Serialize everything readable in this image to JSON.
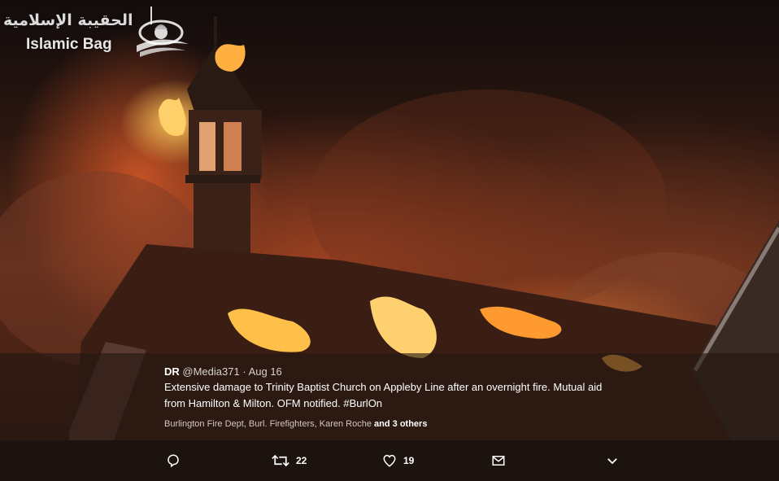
{
  "watermark": {
    "arabic": "الحقيبة الإسلامية",
    "latin": "Islamic Bag"
  },
  "tweet": {
    "display_name": "DR",
    "handle": "@Media371",
    "separator": "·",
    "date": "Aug 16",
    "text": "Extensive damage to Trinity Baptist Church on Appleby Line after an overnight fire. Mutual aid from Hamilton & Milton. OFM notified. #BurlOn",
    "liked_by_names": "Burlington Fire Dept, Burl. Firefighters, Karen Roche",
    "liked_by_and": "and",
    "liked_by_others": "3 others"
  },
  "actions": {
    "reply_icon": "reply-icon",
    "retweet_icon": "retweet-icon",
    "retweet_count": "22",
    "like_icon": "heart-icon",
    "like_count": "19",
    "message_icon": "envelope-icon",
    "more_icon": "chevron-down-icon"
  }
}
